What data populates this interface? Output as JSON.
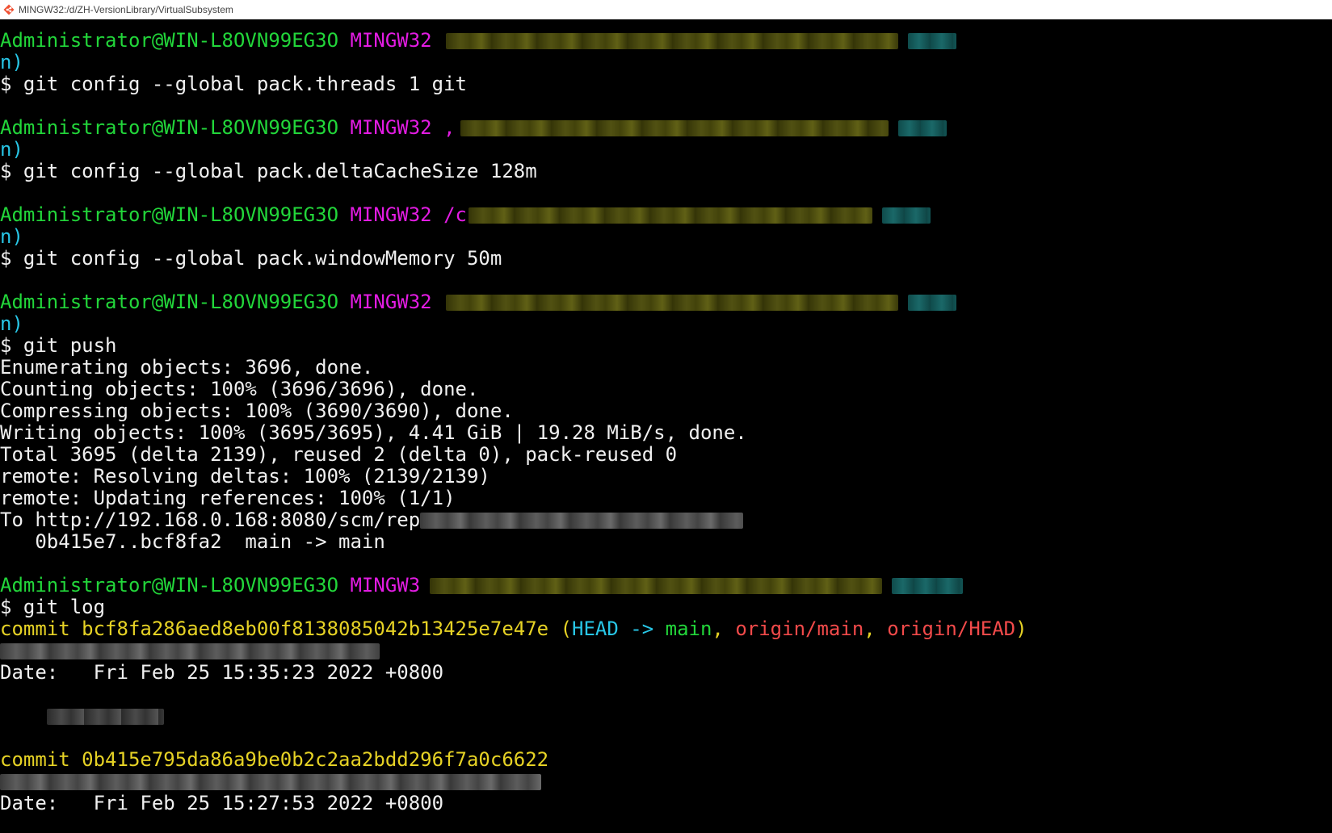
{
  "window": {
    "title": "MINGW32:/d/ZH-VersionLibrary/VirtualSubsystem",
    "icon": "git-bash-icon"
  },
  "terminal": {
    "prompt_user": "Administrator@WIN-L8OVN99EG3O",
    "prompt_env": "MINGW32",
    "prompt_env_partial": "MINGW3",
    "prompt_path_start_2": ",",
    "prompt_path_start_3": "/c",
    "branch_tail": "n)",
    "prompt_symbol": "$",
    "commands": [
      "git config --global pack.threads 1 git",
      "git config --global pack.deltaCacheSize 128m",
      "git config --global pack.windowMemory 50m",
      "git push",
      "git log"
    ],
    "push_output": [
      "Enumerating objects: 3696, done.",
      "Counting objects: 100% (3696/3696), done.",
      "Compressing objects: 100% (3690/3690), done.",
      "Writing objects: 100% (3695/3695), 4.41 GiB | 19.28 MiB/s, done.",
      "Total 3695 (delta 2139), reused 2 (delta 0), pack-reused 0",
      "remote: Resolving deltas: 100% (2139/2139)",
      "remote: Updating references: 100% (1/1)",
      "To http://192.168.0.168:8080/scm/rep",
      "   0b415e7..bcf8fa2  main -> main"
    ],
    "log": {
      "commit1": {
        "label": "commit bcf8fa286aed8eb00f8138085042b13425e7e47e",
        "open_paren": " (",
        "head": "HEAD -> ",
        "branch": "main",
        "sep1": ", ",
        "origin_main": "origin/main",
        "sep2": ", ",
        "origin_head": "origin/HEAD",
        "close_paren": ")",
        "date": "Date:   Fri Feb 25 15:35:23 2022 +0800"
      },
      "commit2": {
        "label": "commit 0b415e795da86a9be0b2c2aa2bdd296f7a0c6622",
        "date": "Date:   Fri Feb 25 15:27:53 2022 +0800"
      }
    }
  }
}
